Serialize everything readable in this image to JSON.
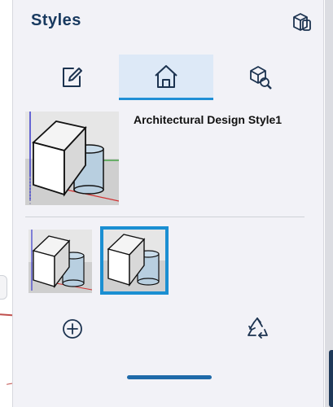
{
  "panel": {
    "title": "Styles",
    "header_icon": "model-info-icon"
  },
  "tabs": [
    {
      "name": "edit",
      "icon": "edit-icon",
      "active": false
    },
    {
      "name": "home",
      "icon": "home-icon",
      "active": true
    },
    {
      "name": "inspect",
      "icon": "inspect-model-icon",
      "active": false
    }
  ],
  "current_style": {
    "name": "Architectural Design Style1"
  },
  "in_model_styles": [
    {
      "icon": "style-thumbnail",
      "selected": false
    },
    {
      "icon": "style-thumbnail",
      "selected": true
    }
  ],
  "actions": {
    "add_icon": "add-circle-icon",
    "purge_icon": "recycle-icon"
  },
  "colors": {
    "title": "#18395f",
    "accent": "#1f8fd6",
    "active_tab_bg": "#dde9f7",
    "panel_bg": "#f2f2f7"
  }
}
